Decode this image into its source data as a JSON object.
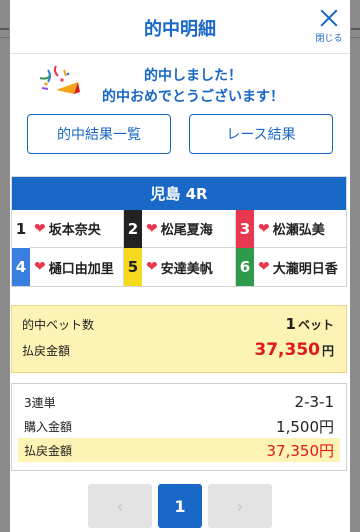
{
  "modal": {
    "title": "的中明細",
    "close_label": "閉じる"
  },
  "congrats": {
    "line1": "的中しました！",
    "line2": "的中おめでとうございます！"
  },
  "buttons": {
    "hit_results": "的中結果一覧",
    "race_results": "レース結果"
  },
  "race": {
    "title": "児島 4R",
    "racers": [
      {
        "num": "1",
        "name": "坂本奈央",
        "bg": "#ffffff",
        "fg": "#222222"
      },
      {
        "num": "2",
        "name": "松尾夏海",
        "bg": "#222222",
        "fg": "#ffffff"
      },
      {
        "num": "3",
        "name": "松瀬弘美",
        "bg": "#e8384f",
        "fg": "#ffffff"
      },
      {
        "num": "4",
        "name": "樋口由加里",
        "bg": "#3a7fe0",
        "fg": "#ffffff"
      },
      {
        "num": "5",
        "name": "安達美帆",
        "bg": "#f5da1e",
        "fg": "#222222"
      },
      {
        "num": "6",
        "name": "大瀧明日香",
        "bg": "#2e9b4c",
        "fg": "#ffffff"
      }
    ]
  },
  "summary": {
    "bets_label": "的中ベット数",
    "bets_value": "1",
    "bets_unit": "ベット",
    "payout_label": "払戻金額",
    "payout_value": "37,350",
    "payout_unit": "円"
  },
  "detail": {
    "type_label": "3連単",
    "type_value": "2-3-1",
    "purchase_label": "購入金額",
    "purchase_value": "1,500円",
    "payout_label": "払戻金額",
    "payout_value": "37,350円"
  },
  "pager": {
    "prev": "‹",
    "current": "1",
    "next": "›"
  },
  "colors": {
    "accent": "#1967c6",
    "highlight": "#fdf3b4",
    "payout_red": "#e0191c"
  }
}
